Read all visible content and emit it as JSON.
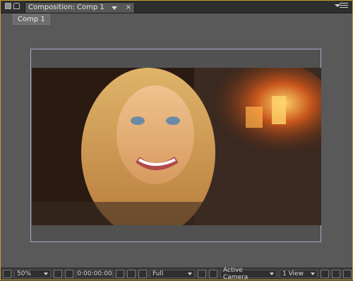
{
  "panel": {
    "tab_title": "Composition: Comp 1",
    "breadcrumb": "Comp 1"
  },
  "bottombar": {
    "zoom": "50%",
    "timecode": "0:00:00:00",
    "resolution": "Full",
    "camera": "Active Camera",
    "view_layout": "1 View"
  },
  "icons": {
    "panel_icon": "panel-icon",
    "lock": "lock-icon",
    "close": "close-icon",
    "menu": "panel-menu-icon",
    "snapshot": "camera-icon",
    "show_snapshot": "person-icon",
    "channels": "rgb-channels-icon",
    "roi": "region-of-interest-icon",
    "transparency": "transparency-grid-icon",
    "grid": "grid-icon",
    "safe_zones": "safe-zones-icon",
    "fast_previews": "fast-previews-icon",
    "flowchart": "flowchart-icon",
    "toggle_view": "toggle-view-icon"
  },
  "colors": {
    "panel_border": "#c9a02a",
    "frame_border": "#a9acd0",
    "viewer_bg": "#595959"
  }
}
